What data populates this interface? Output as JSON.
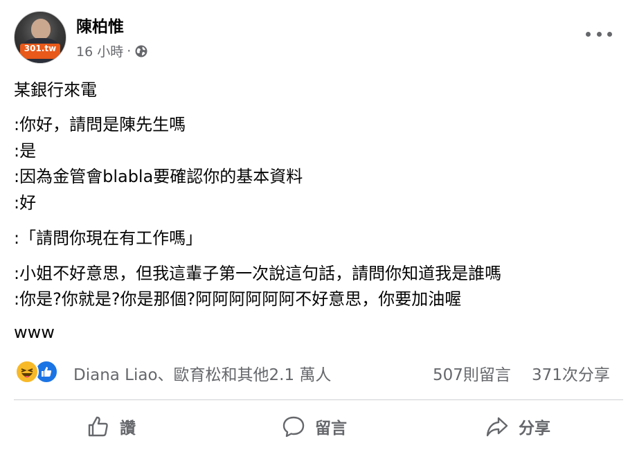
{
  "post": {
    "author": "陳柏惟",
    "time": "16 小時",
    "separator": "·",
    "privacy_icon": "globe-icon",
    "avatar_badge": "301.tw",
    "lines": [
      "某銀行來電",
      ":你好，請問是陳先生嗎",
      ":是",
      ":因為金管會blabla要確認你的基本資料",
      ":好",
      ":「請問你現在有工作嗎」",
      ":小姐不好意思，但我這輩子第一次說這句話，請問你知道我是誰嗎",
      ":你是?你就是?你是那個?阿阿阿阿阿阿不好意思，你要加油喔",
      "www"
    ]
  },
  "stats": {
    "reaction_icons": [
      "haha-icon",
      "like-icon"
    ],
    "reactors": "Diana Liao、歐育松和其他2.1 萬人",
    "comments": "507則留言",
    "shares": "371次分享"
  },
  "actions": {
    "like": "讚",
    "comment": "留言",
    "share": "分享"
  },
  "colors": {
    "text": "#050505",
    "secondary": "#65676b",
    "like_blue": "#1b74e4",
    "haha_yellow": "#f7b928",
    "divider": "#ced0d4"
  }
}
